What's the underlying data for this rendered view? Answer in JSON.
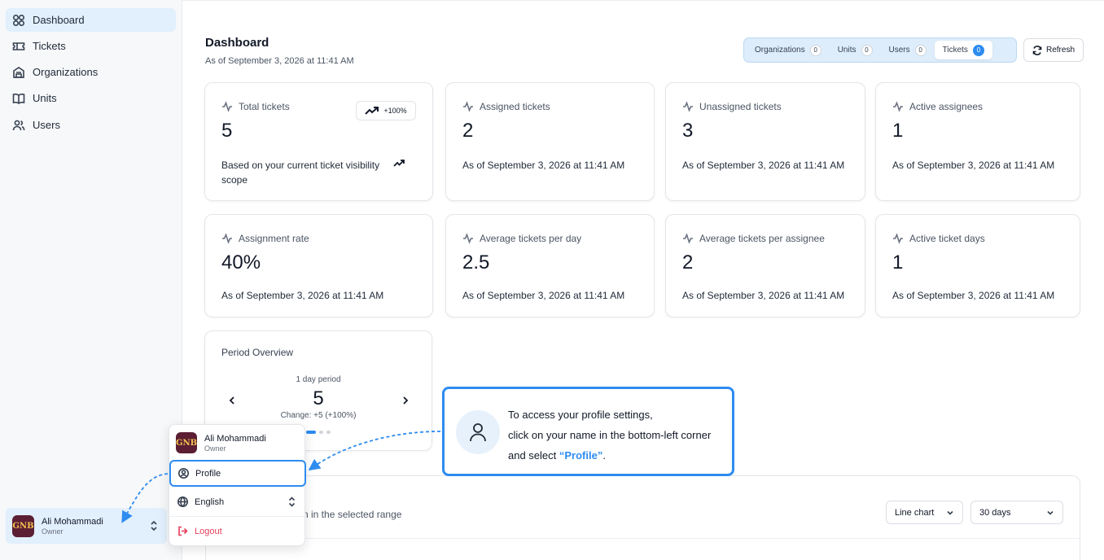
{
  "sidebar": {
    "items": [
      {
        "label": "Dashboard",
        "icon": "grid-icon",
        "active": true
      },
      {
        "label": "Tickets",
        "icon": "ticket-icon"
      },
      {
        "label": "Organizations",
        "icon": "building-icon"
      },
      {
        "label": "Units",
        "icon": "book-icon"
      },
      {
        "label": "Users",
        "icon": "users-icon"
      }
    ],
    "user": {
      "name": "Ali Mohammadi",
      "role": "Owner",
      "avatar_text": "GNB"
    }
  },
  "header": {
    "title": "Dashboard",
    "subtitle": "As of September 3, 2026 at 11:41 AM",
    "tabs": [
      {
        "label": "Organizations",
        "count": "0"
      },
      {
        "label": "Units",
        "count": "0"
      },
      {
        "label": "Users",
        "count": "0"
      },
      {
        "label": "Tickets",
        "count": "0",
        "active": true
      }
    ],
    "refresh_label": "Refresh"
  },
  "stats": [
    {
      "label": "Total tickets",
      "value": "5",
      "foot": "Based on your current ticket visibility scope",
      "badge": "+100%"
    },
    {
      "label": "Assigned tickets",
      "value": "2",
      "foot": "As of September 3, 2026 at 11:41 AM"
    },
    {
      "label": "Unassigned tickets",
      "value": "3",
      "foot": "As of September 3, 2026 at 11:41 AM"
    },
    {
      "label": "Active assignees",
      "value": "1",
      "foot": "As of September 3, 2026 at 11:41 AM"
    },
    {
      "label": "Assignment rate",
      "value": "40%",
      "foot": "As of September 3, 2026 at 11:41 AM"
    },
    {
      "label": "Average tickets per day",
      "value": "2.5",
      "foot": "As of September 3, 2026 at 11:41 AM"
    },
    {
      "label": "Average tickets per assignee",
      "value": "2",
      "foot": "As of September 3, 2026 at 11:41 AM"
    },
    {
      "label": "Active ticket days",
      "value": "1",
      "foot": "As of September 3, 2026 at 11:41 AM"
    }
  ],
  "period": {
    "title": "Period Overview",
    "sub": "1 day period",
    "value": "5",
    "change": "Change: +5 (+100%)"
  },
  "bottom": {
    "desc": "n in the selected range",
    "chart_type": "Line chart",
    "range": "30 days"
  },
  "menu": {
    "name": "Ali Mohammadi",
    "role": "Owner",
    "profile": "Profile",
    "language": "English",
    "logout": "Logout"
  },
  "callout": {
    "line1": "To access your profile settings,",
    "line2": "click on your name in the bottom-left corner",
    "line3_pre": "and select ",
    "line3_hl": "“Profile”",
    "line3_post": "."
  },
  "colors": {
    "accent": "#2d8cf0",
    "active_bg": "#e2effc",
    "logout": "#e53e5a"
  }
}
